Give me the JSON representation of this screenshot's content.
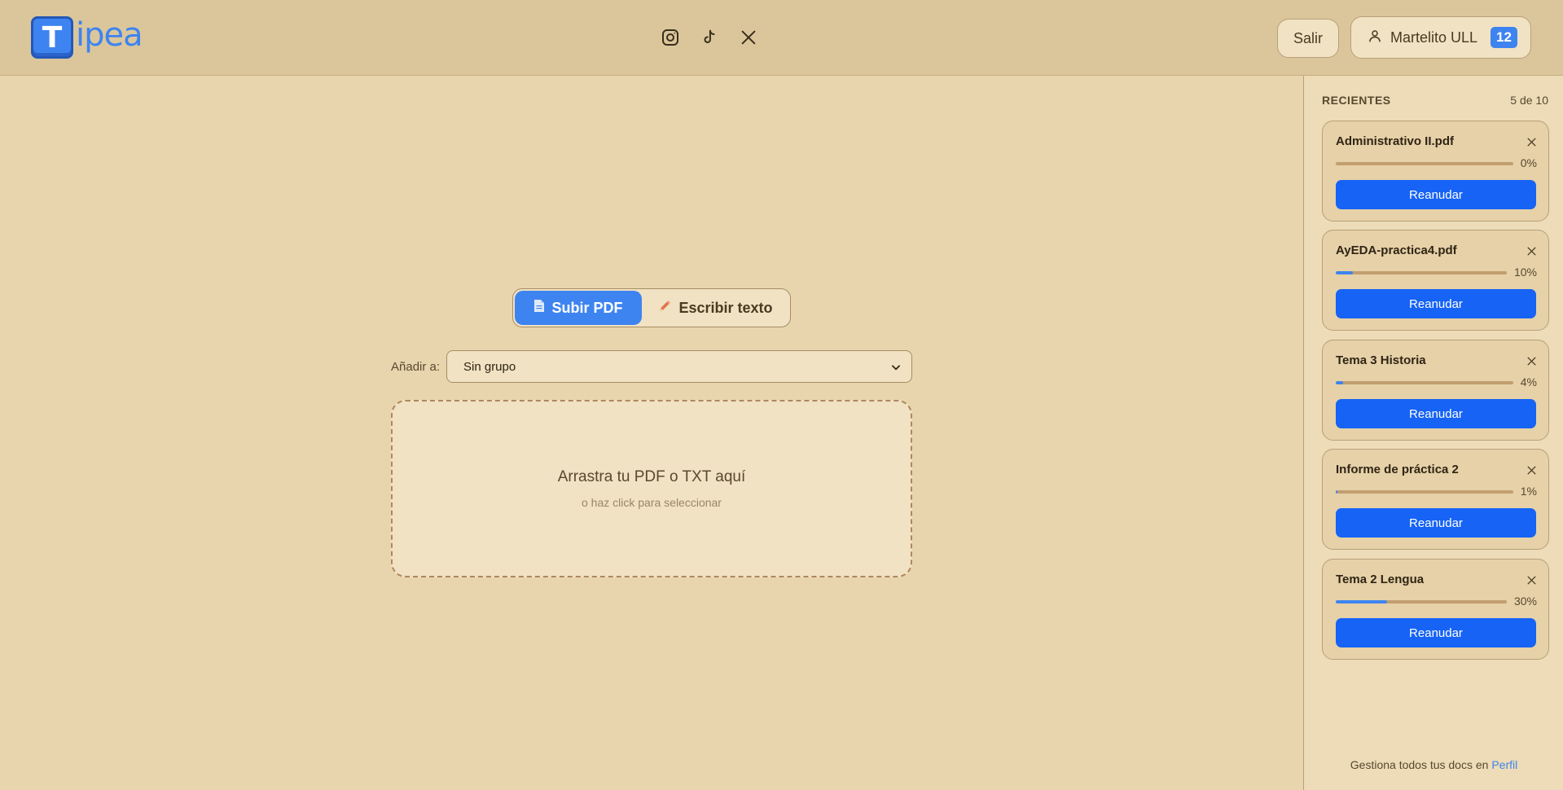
{
  "brand": {
    "logo_letter": "T",
    "logo_text": "ipea",
    "color": "#3e84f0"
  },
  "header": {
    "socials": [
      {
        "icon": "instagram-icon"
      },
      {
        "icon": "tiktok-icon"
      },
      {
        "icon": "x-icon"
      }
    ],
    "logout_label": "Salir",
    "user_name": "Martelito ULL",
    "user_badge": "12"
  },
  "main": {
    "tabs": [
      {
        "label": "Subir PDF",
        "icon": "document-icon",
        "active": true
      },
      {
        "label": "Escribir texto",
        "icon": "pencil-icon",
        "active": false
      }
    ],
    "add_to_label": "Añadir a:",
    "group_select_value": "Sin grupo",
    "dropzone_title": "Arrastra tu PDF o TXT aquí",
    "dropzone_subtitle": "o haz click para seleccionar"
  },
  "sidebar": {
    "title": "RECIENTES",
    "count": "5 de 10",
    "resume_label": "Reanudar",
    "items": [
      {
        "name": "Administrativo II.pdf",
        "progress_label": "0%",
        "progress": 0
      },
      {
        "name": "AyEDA-practica4.pdf",
        "progress_label": "10%",
        "progress": 0.1
      },
      {
        "name": "Tema 3 Historia",
        "progress_label": "4%",
        "progress": 0.04
      },
      {
        "name": "Informe de práctica 2",
        "progress_label": "1%",
        "progress": 0.01
      },
      {
        "name": "Tema 2 Lengua",
        "progress_label": "30%",
        "progress": 0.3
      }
    ],
    "footer_text": "Gestiona todos tus docs en",
    "footer_link": "Perfil"
  },
  "colors": {
    "accent": "#3e84f0",
    "button": "#1663f5",
    "background": "#e8d5ae"
  }
}
